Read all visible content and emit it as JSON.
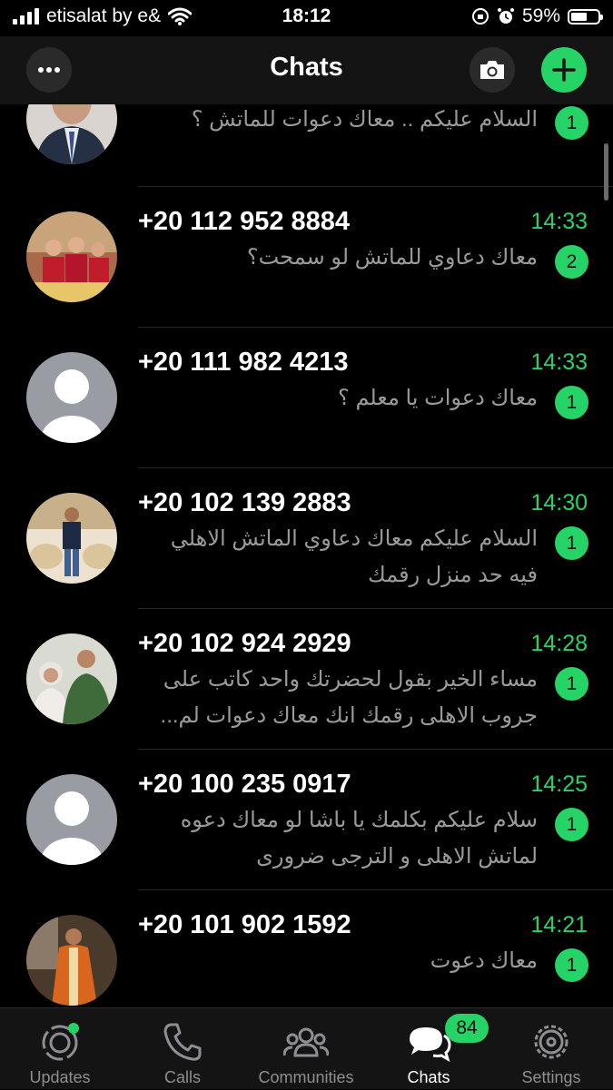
{
  "status_bar": {
    "carrier": "etisalat by e&",
    "time": "18:12",
    "battery": "59%",
    "battery_level": 0.59
  },
  "header": {
    "title": "Chats",
    "more_icon": "ellipsis-icon",
    "camera_icon": "camera-icon",
    "add_icon": "plus-icon"
  },
  "chats": [
    {
      "name": "",
      "time": "",
      "message": "السلام عليكم .. معاك دعوات للماتش ؟",
      "unread": "1",
      "avatar": "photo-man-suit"
    },
    {
      "name": "+20 112 952 8884",
      "time": "14:33",
      "message": "معاك دعاوي للماتش لو سمحت؟",
      "unread": "2",
      "avatar": "photo-group"
    },
    {
      "name": "+20 111 982 4213",
      "time": "14:33",
      "message": "معاك دعوات يا معلم ؟",
      "unread": "1",
      "avatar": "default-avatar"
    },
    {
      "name": "+20 102 139 2883",
      "time": "14:30",
      "message": "السلام عليكم معاك دعاوي الماتش الاهلي فيه حد منزل رقمك",
      "unread": "1",
      "avatar": "photo-man-standing"
    },
    {
      "name": "+20 102 924 2929",
      "time": "14:28",
      "message": "مساء الخير بقول لحضرتك واحد كاتب على جروب الاهلى رقمك انك معاك دعوات لم...",
      "unread": "1",
      "avatar": "photo-couple"
    },
    {
      "name": "+20 100 235 0917",
      "time": "14:25",
      "message": "سلام عليكم بكلمك يا باشا لو معاك دعوه لماتش الاهلى و الترجى ضرورى",
      "unread": "1",
      "avatar": "default-avatar"
    },
    {
      "name": "+20 101 902 1592",
      "time": "14:21",
      "message": "معاك دعوت",
      "unread": "1",
      "avatar": "photo-man-robe"
    }
  ],
  "tabs": [
    {
      "label": "Updates",
      "icon": "updates-icon",
      "active": false
    },
    {
      "label": "Calls",
      "icon": "phone-icon",
      "active": false
    },
    {
      "label": "Communities",
      "icon": "communities-icon",
      "active": false
    },
    {
      "label": "Chats",
      "icon": "chats-icon",
      "active": true,
      "badge": "84"
    },
    {
      "label": "Settings",
      "icon": "gear-icon",
      "active": false
    }
  ],
  "colors": {
    "accent": "#25d366",
    "background": "#000000",
    "bar": "#141414",
    "muted_text": "#9a9a9a"
  }
}
